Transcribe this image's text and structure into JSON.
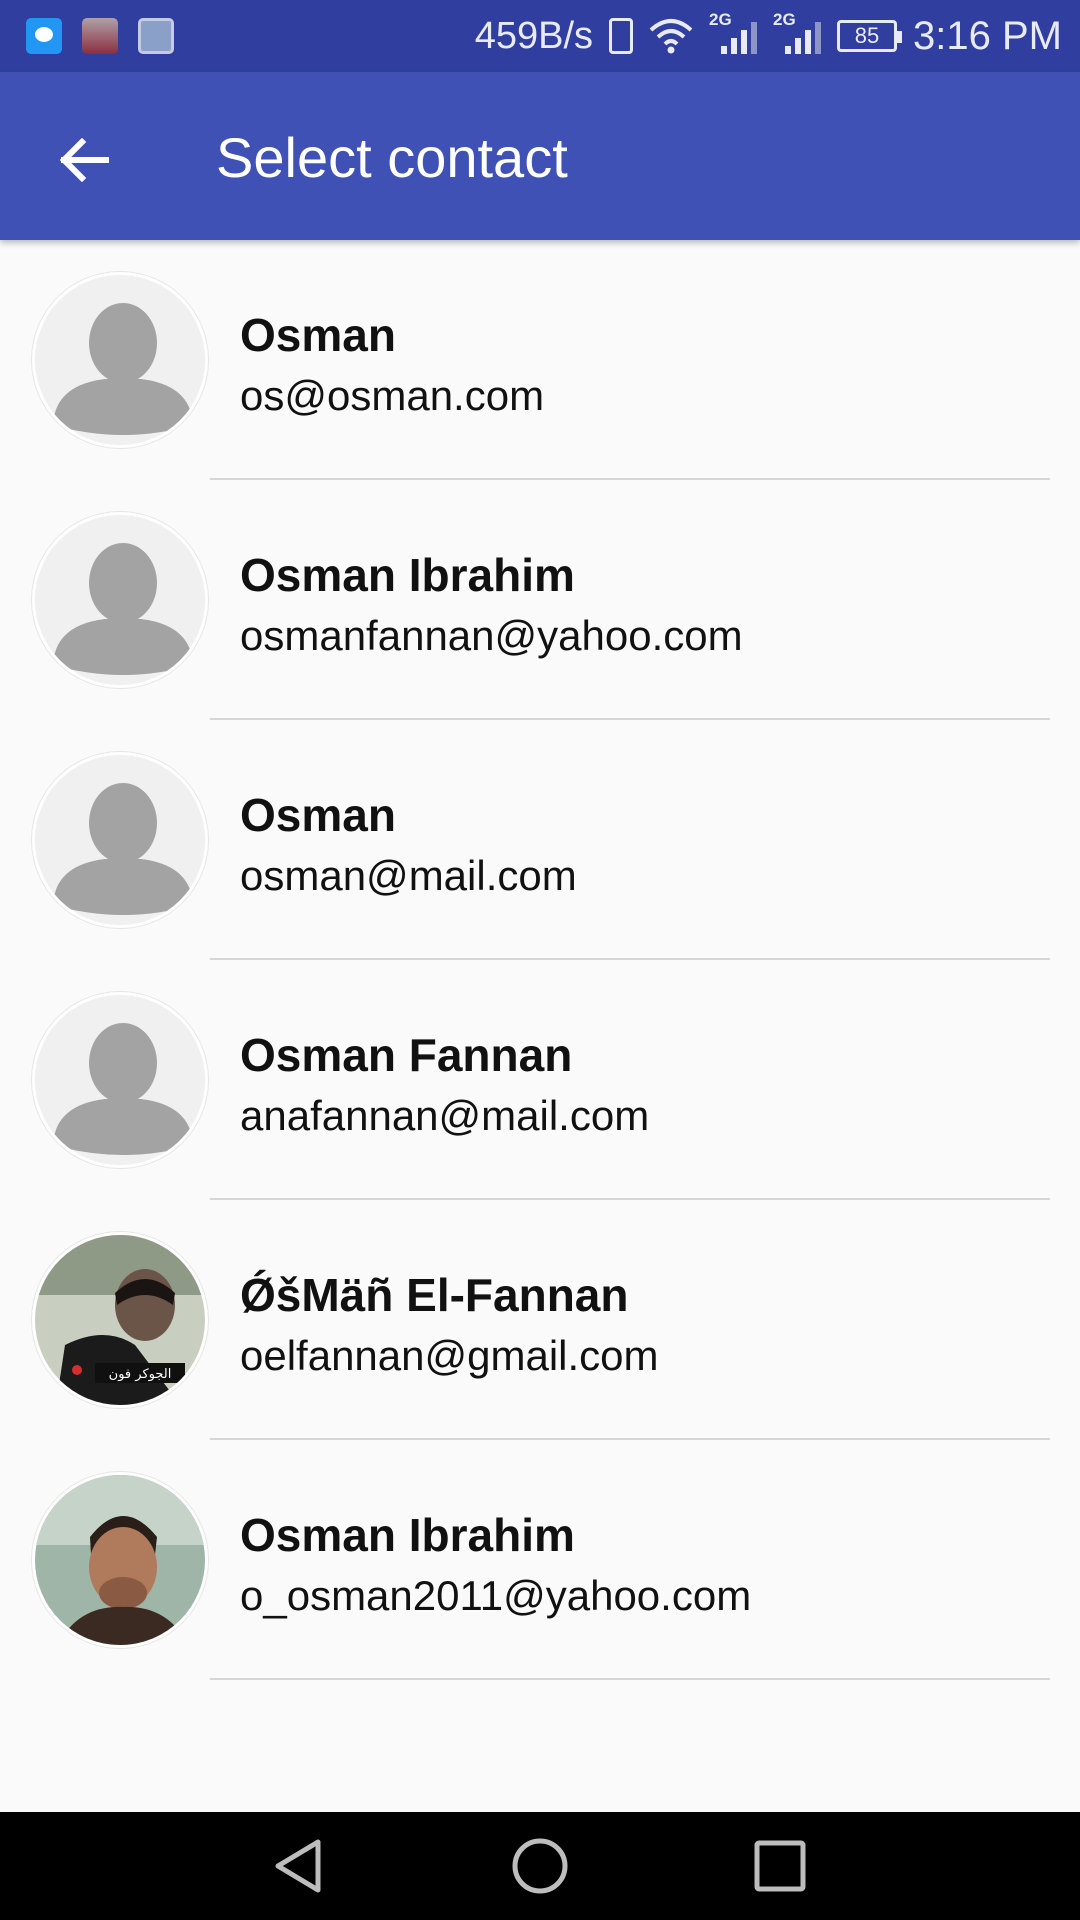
{
  "status_bar": {
    "network_speed": "459B/s",
    "network_type_1": "2G",
    "network_type_2": "2G",
    "battery": "85",
    "time": "3:16 PM",
    "icons": [
      "message-notification-icon",
      "photo-notification-icon",
      "gallery-notification-icon",
      "vibrate-icon",
      "wifi-icon",
      "signal-icon",
      "signal-icon",
      "battery-icon"
    ]
  },
  "app_bar": {
    "title": "Select contact",
    "back_icon": "arrow-back-icon",
    "color": "#3f51b5"
  },
  "contacts": [
    {
      "name": "Osman",
      "email": "os@osman.com",
      "avatar": "default-person-icon"
    },
    {
      "name": "Osman Ibrahim",
      "email": "osmanfannan@yahoo.com",
      "avatar": "default-person-icon"
    },
    {
      "name": "Osman",
      "email": "osman@mail.com",
      "avatar": "default-person-icon"
    },
    {
      "name": "Osman Fannan",
      "email": "anafannan@mail.com",
      "avatar": "default-person-icon"
    },
    {
      "name": "ǾšMäñ El-Fannan",
      "email": "oelfannan@gmail.com",
      "avatar": "photo"
    },
    {
      "name": "Osman Ibrahim",
      "email": "o_osman2011@yahoo.com",
      "avatar": "photo"
    }
  ],
  "nav_bar": {
    "back_icon": "nav-back-icon",
    "home_icon": "nav-home-icon",
    "recents_icon": "nav-recents-icon"
  }
}
